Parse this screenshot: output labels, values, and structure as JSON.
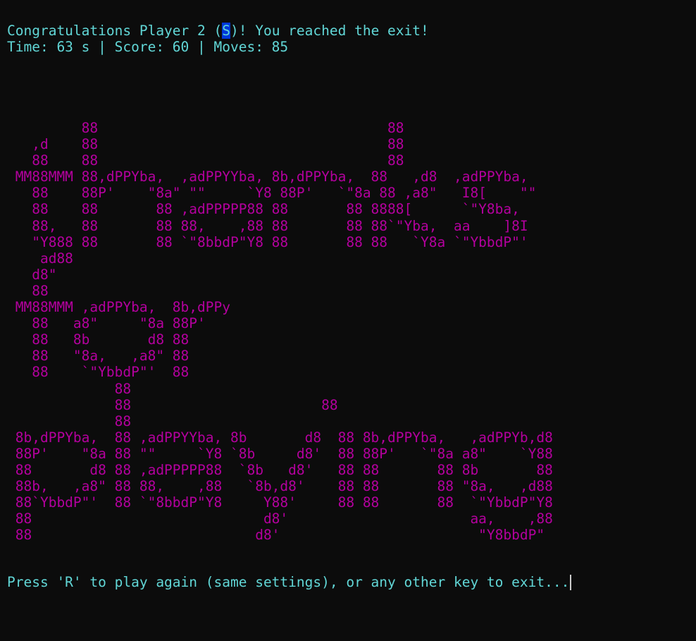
{
  "terminal": {
    "header": {
      "line1_before": "Congratulations Player 2 (",
      "line1_symbol": "S",
      "line1_after": ")! You reached the exit!",
      "line2": "Time: 63 s | Score: 60 | Moves: 85"
    },
    "banner_lines": [
      "         88                                   88",
      "   ,d    88                                   88",
      "   88    88                                   88",
      " MM88MMM 88,dPPYba,  ,adPPYYba, 8b,dPPYba,  88   ,d8  ,adPPYba,",
      "   88    88P'    \"8a\" \"\"     `Y8 88P'   `\"8a 88 ,a8\"   I8[    \"\"",
      "   88    88       88 ,adPPPPP88 88       88 8888[      `\"Y8ba,",
      "   88,   88       88 88,    ,88 88       88 88`\"Yba,  aa    ]8I",
      "   \"Y888 88       88 `\"8bbdP\"Y8 88       88 88   `Y8a `\"YbbdP\"'",
      "    ad88",
      "   d8\"",
      "   88",
      " MM88MMM ,adPPYba,  8b,dPPy",
      "   88   a8\"     \"8a 88P'",
      "   88   8b       d8 88",
      "   88   \"8a,   ,a8\" 88",
      "   88    `\"YbbdP\"'  88",
      "             88",
      "             88                       88",
      "             88",
      " 8b,dPPYba,  88 ,adPPYYba, 8b       d8  88 8b,dPPYba,   ,adPPYb,d8",
      " 88P'    \"8a 88 \"\"     `Y8 `8b     d8'  88 88P'   `\"8a a8\"    `Y88",
      " 88       d8 88 ,adPPPPP88  `8b   d8'   88 88       88 8b       88",
      " 88b,   ,a8\" 88 88,    ,88   `8b,d8'    88 88       88 \"8a,   ,d88",
      " 88`YbbdP\"'  88 `\"8bbdP\"Y8     Y88'     88 88       88  `\"YbbdP\"Y8",
      " 88                            d8'                      aa,    ,88",
      " 88                           d8'                        \"Y8bbdP\""
    ],
    "prompt": "Press 'R' to play again (same settings), or any other key to exit..."
  },
  "colors": {
    "background": "#0c0c0c",
    "cyan_text": "#61d6d6",
    "magenta_banner": "#b4009e",
    "highlight": "#0037da"
  }
}
